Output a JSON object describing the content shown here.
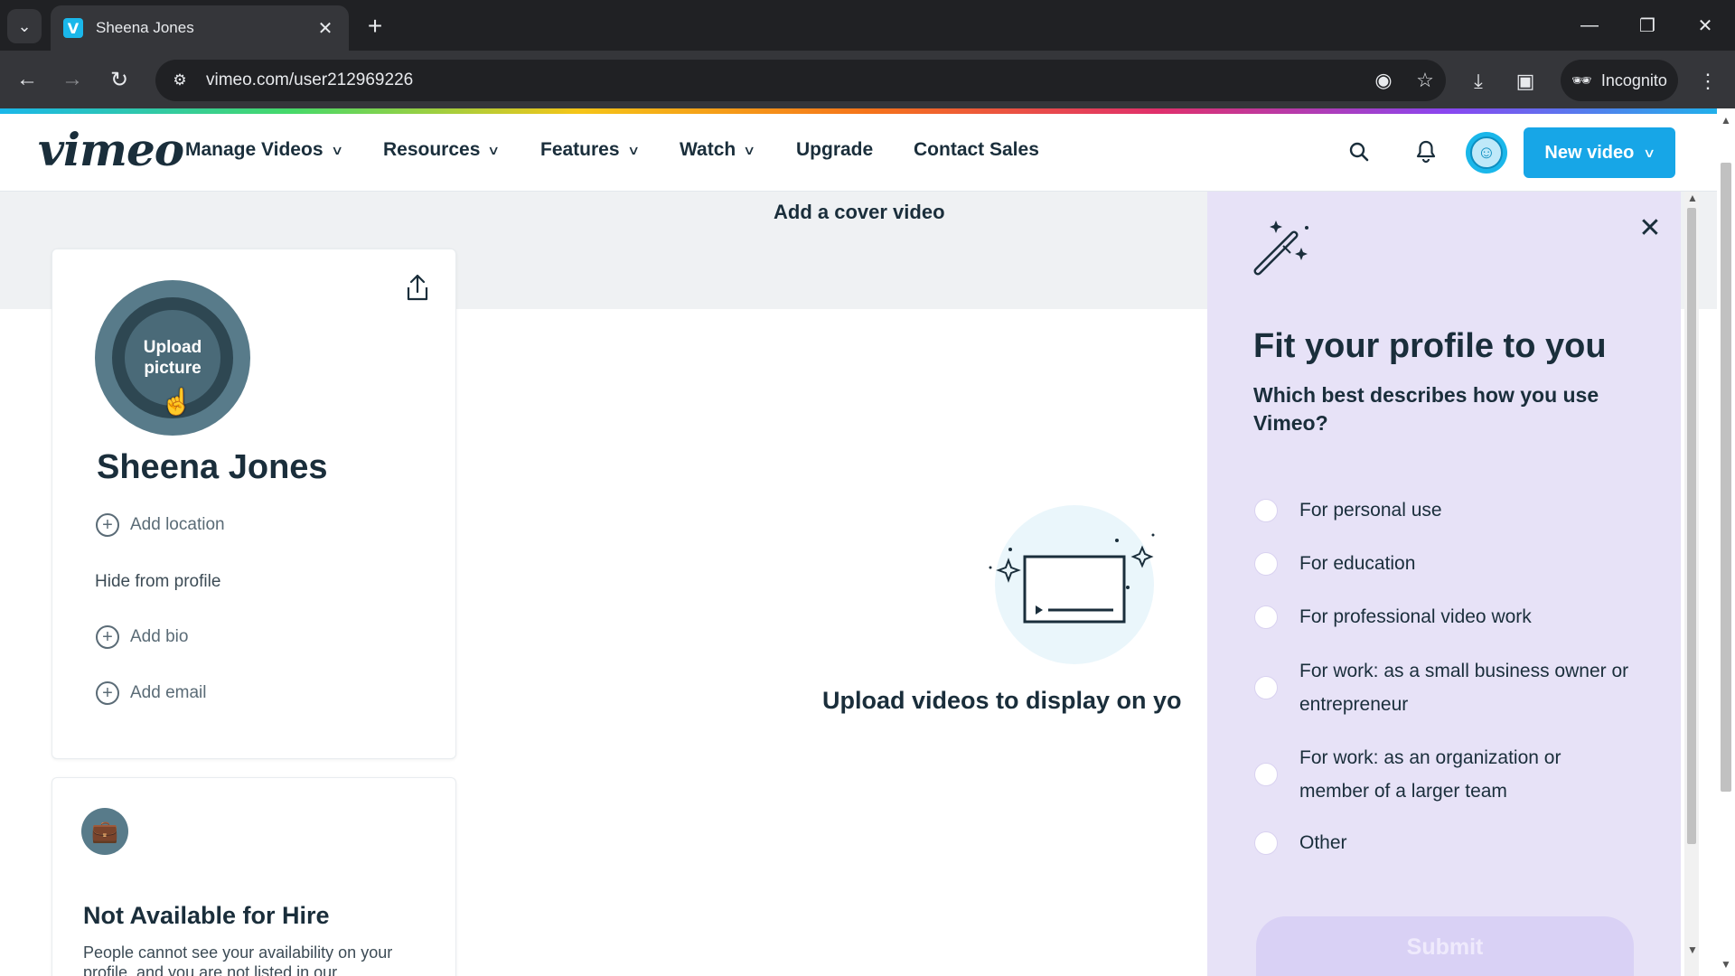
{
  "browser": {
    "tab_title": "Sheena Jones",
    "favicon_letter": "V",
    "url": "vimeo.com/user212969226",
    "incognito_label": "Incognito"
  },
  "header": {
    "logo": "vimeo",
    "menu": [
      {
        "label": "Manage Videos",
        "has_dropdown": true
      },
      {
        "label": "Resources",
        "has_dropdown": true
      },
      {
        "label": "Features",
        "has_dropdown": true
      },
      {
        "label": "Watch",
        "has_dropdown": true
      },
      {
        "label": "Upgrade",
        "has_dropdown": false
      },
      {
        "label": "Contact Sales",
        "has_dropdown": false
      }
    ],
    "new_video_label": "New video"
  },
  "cover": {
    "label": "Add a cover video"
  },
  "profile": {
    "upload_picture_label": "Upload picture",
    "name": "Sheena Jones",
    "add_location": "Add location",
    "hide_from_profile": "Hide from profile",
    "add_bio": "Add bio",
    "add_email": "Add email"
  },
  "hire": {
    "title": "Not Available for Hire",
    "description": "People cannot see your availability on your profile, and you are not listed in our"
  },
  "empty_state": {
    "text": "Upload videos to display on yo"
  },
  "panel": {
    "title": "Fit your profile to you",
    "question": "Which best describes how you use Vimeo?",
    "options": [
      "For personal use",
      "For education",
      "For professional video work",
      "For work: as a small business owner or entrepreneur",
      "For work: as an organization or member of a larger team",
      "Other"
    ],
    "submit_label": "Submit"
  },
  "colors": {
    "brand_blue": "#17a6e7",
    "panel_bg": "#e7e2f7",
    "text_dark": "#1a2e3b"
  },
  "icons": {
    "search": "search-icon",
    "bell": "bell-icon",
    "share": "share-icon",
    "wand": "magic-wand-icon",
    "close": "close-icon"
  }
}
